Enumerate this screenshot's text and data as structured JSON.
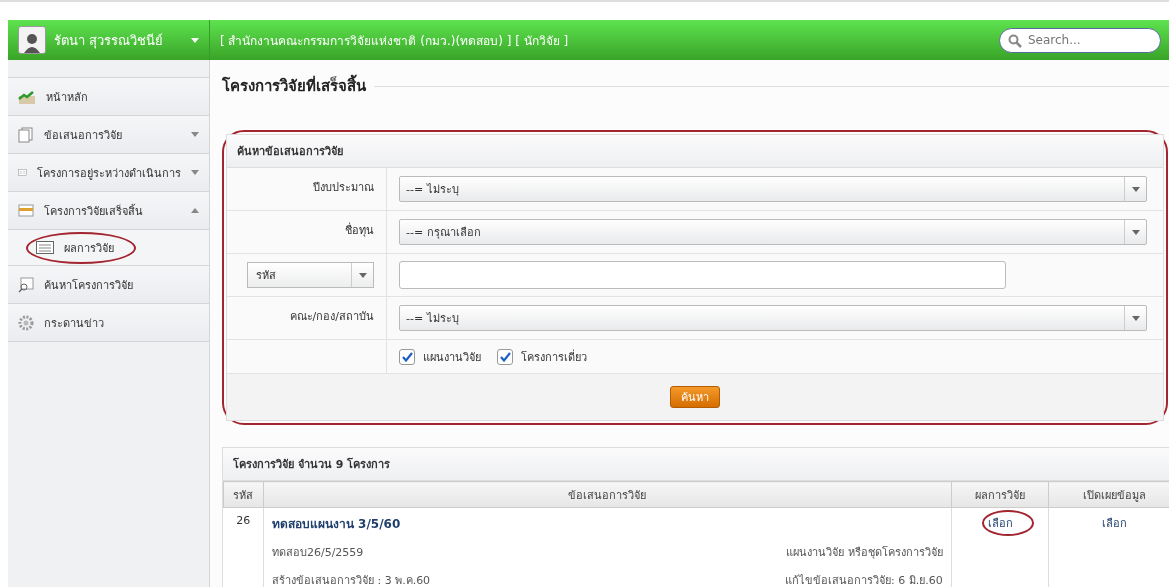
{
  "header": {
    "user_name": "รัตนา สุวรรณวิชนีย์",
    "org": "[ สำนักงานคณะกรรมการวิจัยแห่งชาติ (กมว.)(ทดสอบ) ] [ นักวิจัย ]",
    "search": {
      "placeholder": "Search..."
    }
  },
  "sidebar": {
    "items": [
      {
        "label": "หน้าหลัก"
      },
      {
        "label": "ข้อเสนอการวิจัย",
        "expanded": false
      },
      {
        "label": "โครงการอยู่ระหว่างดำเนินการ",
        "expanded": false
      },
      {
        "label": "โครงการวิจัยเสร็จสิ้น",
        "expanded": true,
        "children": [
          {
            "label": "ผลการวิจัย",
            "circled": true
          }
        ]
      },
      {
        "label": "ค้นหาโครงการวิจัย"
      },
      {
        "label": "กระดานข่าว"
      }
    ]
  },
  "page_title": "โครงการวิจัยที่เสร็จสิ้น",
  "search_panel": {
    "title": "ค้นหาข้อเสนอการวิจัย",
    "circled": true,
    "rows": [
      {
        "kind": "select",
        "label": "ปีงบประมาณ",
        "value": "--= ไม่ระบุ"
      },
      {
        "kind": "select",
        "label": "ชื่อทุน",
        "value": "--= กรุณาเลือก"
      },
      {
        "kind": "text",
        "selector": "รหัส"
      },
      {
        "kind": "select",
        "label": "คณะ/กอง/สถาบัน",
        "value": "--= ไม่ระบุ"
      },
      {
        "kind": "checks",
        "checks": [
          {
            "label": "แผนงานวิจัย",
            "checked": true
          },
          {
            "label": "โครงการเดี่ยว",
            "checked": true
          }
        ]
      }
    ],
    "button": "ค้นหา"
  },
  "results": {
    "title": "โครงการวิจัย จำนวน 9 โครงการ",
    "columns": [
      "รหัส",
      "ข้อเสนอการวิจัย",
      "ผลการวิจัย",
      "เปิดเผยข้อมูล"
    ],
    "rows": [
      {
        "code": "26",
        "title": "ทดสอบแผนงาน 3/5/60",
        "subtitle": "ทดสอบ26/5/2559",
        "type": "แผนงานวิจัย หรือชุดโครงการวิจัย",
        "created": "สร้างข้อเสนอการวิจัย : 3 พ.ค.60",
        "edited": "แก้ไขข้อเสนอการวิจัย: 6 มิ.ย.60",
        "result_link": "เลือก",
        "result_circled": true,
        "disclose_link": "เลือก"
      }
    ]
  }
}
